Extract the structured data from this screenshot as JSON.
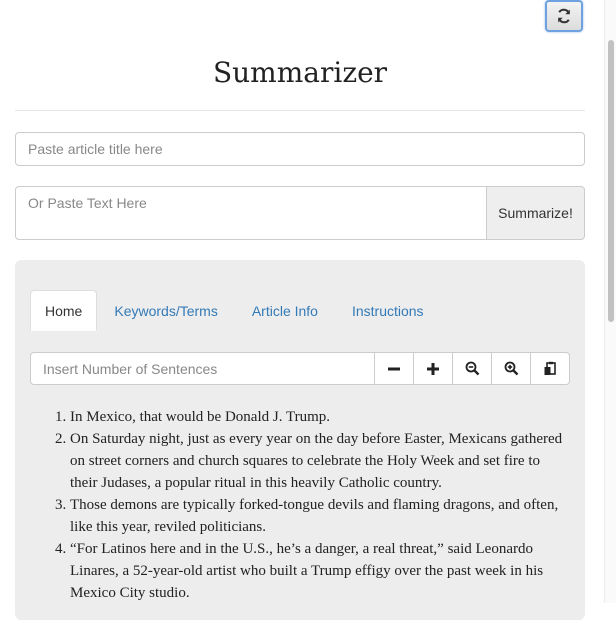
{
  "header": {
    "title": "Summarizer",
    "refresh_icon": "refresh-icon"
  },
  "form": {
    "title_placeholder": "Paste article title here",
    "text_placeholder": "Or Paste Text Here",
    "summarize_label": "Summarize!"
  },
  "tabs": [
    {
      "label": "Home",
      "active": true
    },
    {
      "label": "Keywords/Terms",
      "active": false
    },
    {
      "label": "Article Info",
      "active": false
    },
    {
      "label": "Instructions",
      "active": false
    }
  ],
  "home": {
    "sentences_placeholder": "Insert Number of Sentences",
    "tools": [
      {
        "name": "minus-icon"
      },
      {
        "name": "plus-icon"
      },
      {
        "name": "zoom-out-icon"
      },
      {
        "name": "zoom-in-icon"
      },
      {
        "name": "paste-icon"
      }
    ],
    "summary": [
      "In Mexico, that would be Donald J. Trump.",
      "On Saturday night, just as every year on the day before Easter, Mexicans gathered on street corners and church squares to celebrate the Holy Week and set fire to their Judases, a popular ritual in this heavily Catholic country.",
      "Those demons are typically forked-tongue devils and flaming dragons, and often, like this year, reviled politicians.",
      "“For Latinos here and in the U.S., he’s a danger, a real threat,” said Leonardo Linares, a 52-year-old artist who built a Trump effigy over the past week in his Mexico City studio."
    ]
  },
  "colors": {
    "link": "#337ab7",
    "panel": "#ededed",
    "focus": "#6fa1e0"
  }
}
